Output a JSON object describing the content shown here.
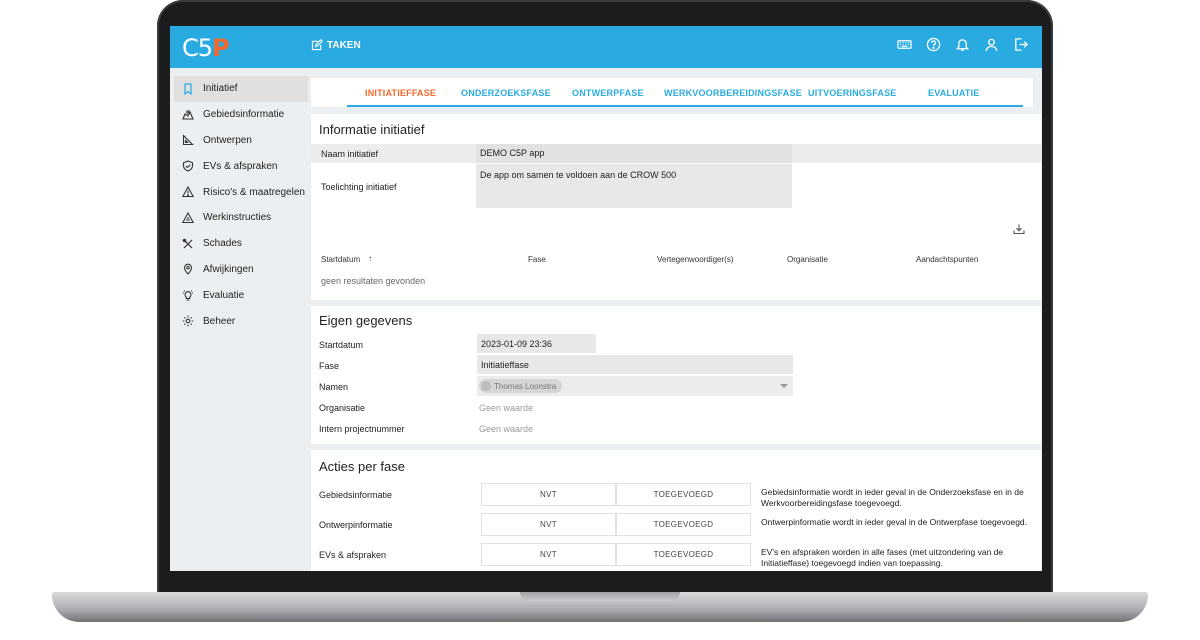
{
  "app": {
    "logo_main": "C5",
    "logo_accent": "P",
    "nav_label": "TAKEN"
  },
  "sidebar": {
    "items": [
      {
        "label": "Initiatief",
        "icon": "bookmark-icon"
      },
      {
        "label": "Gebiedsinformatie",
        "icon": "area-icon"
      },
      {
        "label": "Ontwerpen",
        "icon": "triangle-ruler-icon"
      },
      {
        "label": "EVs & afspraken",
        "icon": "shield-check-icon"
      },
      {
        "label": "Risico's & maatregelen",
        "icon": "warning-icon"
      },
      {
        "label": "Werkinstructies",
        "icon": "instructions-icon"
      },
      {
        "label": "Schades",
        "icon": "tools-icon"
      },
      {
        "label": "Afwijkingen",
        "icon": "location-pin-icon"
      },
      {
        "label": "Evaluatie",
        "icon": "lightbulb-icon"
      },
      {
        "label": "Beheer",
        "icon": "gear-icon"
      }
    ]
  },
  "tabs": [
    {
      "label": "INITIATIEFFASE"
    },
    {
      "label": "ONDERZOEKSFASE"
    },
    {
      "label": "ONTWERPFASE"
    },
    {
      "label": "WERKVOORBEREIDINGSFASE"
    },
    {
      "label": "UITVOERINGSFASE"
    },
    {
      "label": "EVALUATIE"
    }
  ],
  "initiatief": {
    "title": "Informatie initiatief",
    "naam_label": "Naam initiatief",
    "naam_value": "DEMO C5P app",
    "toelichting_label": "Toelichting initiatief",
    "toelichting_value": "De app om samen te voldoen aan de CROW 500",
    "table_headers": [
      "Startdatum",
      "Fase",
      "Vertegenwoordiger(s)",
      "Organisatie",
      "Aandachtspunten"
    ],
    "sort_indicator": "↑",
    "empty_text": "geen resultaten gevonden"
  },
  "eigen": {
    "title": "Eigen gegevens",
    "startdatum_label": "Startdatum",
    "startdatum_value": "2023-01-09 23:36",
    "fase_label": "Fase",
    "fase_value": "Initiatieffase",
    "namen_label": "Namen",
    "namen_chip": "Thomas Loonstra",
    "organisatie_label": "Organisatie",
    "organisatie_value": "Geen waarde",
    "projectnummer_label": "Intern projectnummer",
    "projectnummer_value": "Geen waarde"
  },
  "acties": {
    "title": "Acties per fase",
    "rows": [
      {
        "label": "Gebiedsinformatie",
        "btn1": "NVT",
        "btn2": "TOEGEVOEGD",
        "desc": "Gebiedsinformatie wordt in ieder geval in de Onderzoeksfase en in de Werkvoorbereidingsfase toegevoegd."
      },
      {
        "label": "Ontwerpinformatie",
        "btn1": "NVT",
        "btn2": "TOEGEVOEGD",
        "desc": "Ontwerpinformatie wordt in ieder geval in de Ontwerpfase toegevoegd."
      },
      {
        "label": "EVs & afspraken",
        "btn1": "NVT",
        "btn2": "TOEGEVOEGD",
        "desc": "EV's en afspraken worden in alle fases (met uitzondering van de Initiatieffase) toegevoegd indien van toepassing."
      }
    ]
  },
  "colors": {
    "primary": "#29abe2",
    "accent": "#f26a2e"
  }
}
